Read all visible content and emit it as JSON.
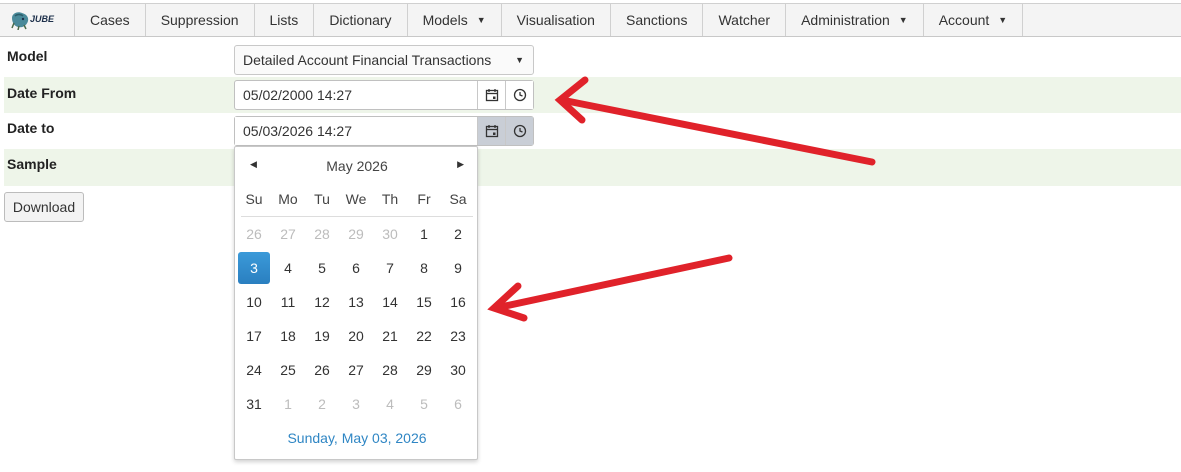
{
  "nav": {
    "logo_text": "JUBE",
    "items": [
      {
        "label": "Cases",
        "dropdown": false
      },
      {
        "label": "Suppression",
        "dropdown": false
      },
      {
        "label": "Lists",
        "dropdown": false
      },
      {
        "label": "Dictionary",
        "dropdown": false
      },
      {
        "label": "Models",
        "dropdown": true
      },
      {
        "label": "Visualisation",
        "dropdown": false
      },
      {
        "label": "Sanctions",
        "dropdown": false
      },
      {
        "label": "Watcher",
        "dropdown": false
      },
      {
        "label": "Administration",
        "dropdown": true
      },
      {
        "label": "Account",
        "dropdown": true
      }
    ]
  },
  "form": {
    "model_label": "Model",
    "model_value": "Detailed Account Financial Transactions",
    "date_from_label": "Date From",
    "date_from_value": "05/02/2000 14:27",
    "date_to_label": "Date to",
    "date_to_value": "05/03/2026 14:27",
    "sample_label": "Sample",
    "download_label": "Download"
  },
  "calendar": {
    "title": "May 2026",
    "weekdays": [
      "Su",
      "Mo",
      "Tu",
      "We",
      "Th",
      "Fr",
      "Sa"
    ],
    "weeks": [
      [
        {
          "d": "26",
          "out": true
        },
        {
          "d": "27",
          "out": true
        },
        {
          "d": "28",
          "out": true
        },
        {
          "d": "29",
          "out": true
        },
        {
          "d": "30",
          "out": true
        },
        {
          "d": "1"
        },
        {
          "d": "2"
        }
      ],
      [
        {
          "d": "3",
          "sel": true
        },
        {
          "d": "4"
        },
        {
          "d": "5"
        },
        {
          "d": "6"
        },
        {
          "d": "7"
        },
        {
          "d": "8"
        },
        {
          "d": "9"
        }
      ],
      [
        {
          "d": "10"
        },
        {
          "d": "11"
        },
        {
          "d": "12"
        },
        {
          "d": "13"
        },
        {
          "d": "14"
        },
        {
          "d": "15"
        },
        {
          "d": "16"
        }
      ],
      [
        {
          "d": "17"
        },
        {
          "d": "18"
        },
        {
          "d": "19"
        },
        {
          "d": "20"
        },
        {
          "d": "21"
        },
        {
          "d": "22"
        },
        {
          "d": "23"
        }
      ],
      [
        {
          "d": "24"
        },
        {
          "d": "25"
        },
        {
          "d": "26"
        },
        {
          "d": "27"
        },
        {
          "d": "28"
        },
        {
          "d": "29"
        },
        {
          "d": "30"
        }
      ],
      [
        {
          "d": "31"
        },
        {
          "d": "1",
          "out": true
        },
        {
          "d": "2",
          "out": true
        },
        {
          "d": "3",
          "out": true
        },
        {
          "d": "4",
          "out": true
        },
        {
          "d": "5",
          "out": true
        },
        {
          "d": "6",
          "out": true
        }
      ]
    ],
    "footer": "Sunday, May 03, 2026",
    "prev_icon": "triangle-left-icon",
    "next_icon": "triangle-right-icon"
  },
  "colors": {
    "accent": "#2f8ccf",
    "row_shade": "#eef5e9",
    "annotation_arrow": "#e0222a"
  }
}
